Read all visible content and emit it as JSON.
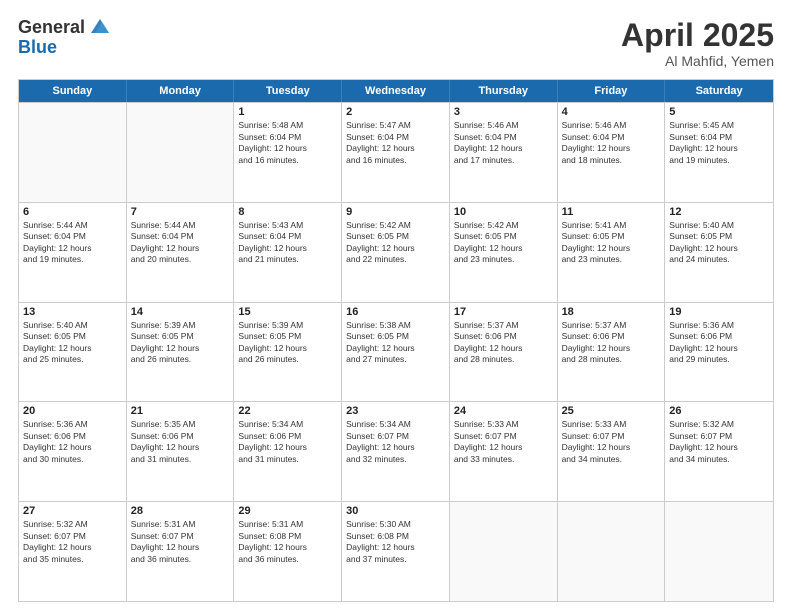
{
  "logo": {
    "general": "General",
    "blue": "Blue"
  },
  "title": {
    "month_year": "April 2025",
    "location": "Al Mahfid, Yemen"
  },
  "header_days": [
    "Sunday",
    "Monday",
    "Tuesday",
    "Wednesday",
    "Thursday",
    "Friday",
    "Saturday"
  ],
  "weeks": [
    [
      {
        "day": "",
        "info": ""
      },
      {
        "day": "",
        "info": ""
      },
      {
        "day": "1",
        "info": "Sunrise: 5:48 AM\nSunset: 6:04 PM\nDaylight: 12 hours\nand 16 minutes."
      },
      {
        "day": "2",
        "info": "Sunrise: 5:47 AM\nSunset: 6:04 PM\nDaylight: 12 hours\nand 16 minutes."
      },
      {
        "day": "3",
        "info": "Sunrise: 5:46 AM\nSunset: 6:04 PM\nDaylight: 12 hours\nand 17 minutes."
      },
      {
        "day": "4",
        "info": "Sunrise: 5:46 AM\nSunset: 6:04 PM\nDaylight: 12 hours\nand 18 minutes."
      },
      {
        "day": "5",
        "info": "Sunrise: 5:45 AM\nSunset: 6:04 PM\nDaylight: 12 hours\nand 19 minutes."
      }
    ],
    [
      {
        "day": "6",
        "info": "Sunrise: 5:44 AM\nSunset: 6:04 PM\nDaylight: 12 hours\nand 19 minutes."
      },
      {
        "day": "7",
        "info": "Sunrise: 5:44 AM\nSunset: 6:04 PM\nDaylight: 12 hours\nand 20 minutes."
      },
      {
        "day": "8",
        "info": "Sunrise: 5:43 AM\nSunset: 6:04 PM\nDaylight: 12 hours\nand 21 minutes."
      },
      {
        "day": "9",
        "info": "Sunrise: 5:42 AM\nSunset: 6:05 PM\nDaylight: 12 hours\nand 22 minutes."
      },
      {
        "day": "10",
        "info": "Sunrise: 5:42 AM\nSunset: 6:05 PM\nDaylight: 12 hours\nand 23 minutes."
      },
      {
        "day": "11",
        "info": "Sunrise: 5:41 AM\nSunset: 6:05 PM\nDaylight: 12 hours\nand 23 minutes."
      },
      {
        "day": "12",
        "info": "Sunrise: 5:40 AM\nSunset: 6:05 PM\nDaylight: 12 hours\nand 24 minutes."
      }
    ],
    [
      {
        "day": "13",
        "info": "Sunrise: 5:40 AM\nSunset: 6:05 PM\nDaylight: 12 hours\nand 25 minutes."
      },
      {
        "day": "14",
        "info": "Sunrise: 5:39 AM\nSunset: 6:05 PM\nDaylight: 12 hours\nand 26 minutes."
      },
      {
        "day": "15",
        "info": "Sunrise: 5:39 AM\nSunset: 6:05 PM\nDaylight: 12 hours\nand 26 minutes."
      },
      {
        "day": "16",
        "info": "Sunrise: 5:38 AM\nSunset: 6:05 PM\nDaylight: 12 hours\nand 27 minutes."
      },
      {
        "day": "17",
        "info": "Sunrise: 5:37 AM\nSunset: 6:06 PM\nDaylight: 12 hours\nand 28 minutes."
      },
      {
        "day": "18",
        "info": "Sunrise: 5:37 AM\nSunset: 6:06 PM\nDaylight: 12 hours\nand 28 minutes."
      },
      {
        "day": "19",
        "info": "Sunrise: 5:36 AM\nSunset: 6:06 PM\nDaylight: 12 hours\nand 29 minutes."
      }
    ],
    [
      {
        "day": "20",
        "info": "Sunrise: 5:36 AM\nSunset: 6:06 PM\nDaylight: 12 hours\nand 30 minutes."
      },
      {
        "day": "21",
        "info": "Sunrise: 5:35 AM\nSunset: 6:06 PM\nDaylight: 12 hours\nand 31 minutes."
      },
      {
        "day": "22",
        "info": "Sunrise: 5:34 AM\nSunset: 6:06 PM\nDaylight: 12 hours\nand 31 minutes."
      },
      {
        "day": "23",
        "info": "Sunrise: 5:34 AM\nSunset: 6:07 PM\nDaylight: 12 hours\nand 32 minutes."
      },
      {
        "day": "24",
        "info": "Sunrise: 5:33 AM\nSunset: 6:07 PM\nDaylight: 12 hours\nand 33 minutes."
      },
      {
        "day": "25",
        "info": "Sunrise: 5:33 AM\nSunset: 6:07 PM\nDaylight: 12 hours\nand 34 minutes."
      },
      {
        "day": "26",
        "info": "Sunrise: 5:32 AM\nSunset: 6:07 PM\nDaylight: 12 hours\nand 34 minutes."
      }
    ],
    [
      {
        "day": "27",
        "info": "Sunrise: 5:32 AM\nSunset: 6:07 PM\nDaylight: 12 hours\nand 35 minutes."
      },
      {
        "day": "28",
        "info": "Sunrise: 5:31 AM\nSunset: 6:07 PM\nDaylight: 12 hours\nand 36 minutes."
      },
      {
        "day": "29",
        "info": "Sunrise: 5:31 AM\nSunset: 6:08 PM\nDaylight: 12 hours\nand 36 minutes."
      },
      {
        "day": "30",
        "info": "Sunrise: 5:30 AM\nSunset: 6:08 PM\nDaylight: 12 hours\nand 37 minutes."
      },
      {
        "day": "",
        "info": ""
      },
      {
        "day": "",
        "info": ""
      },
      {
        "day": "",
        "info": ""
      }
    ]
  ]
}
